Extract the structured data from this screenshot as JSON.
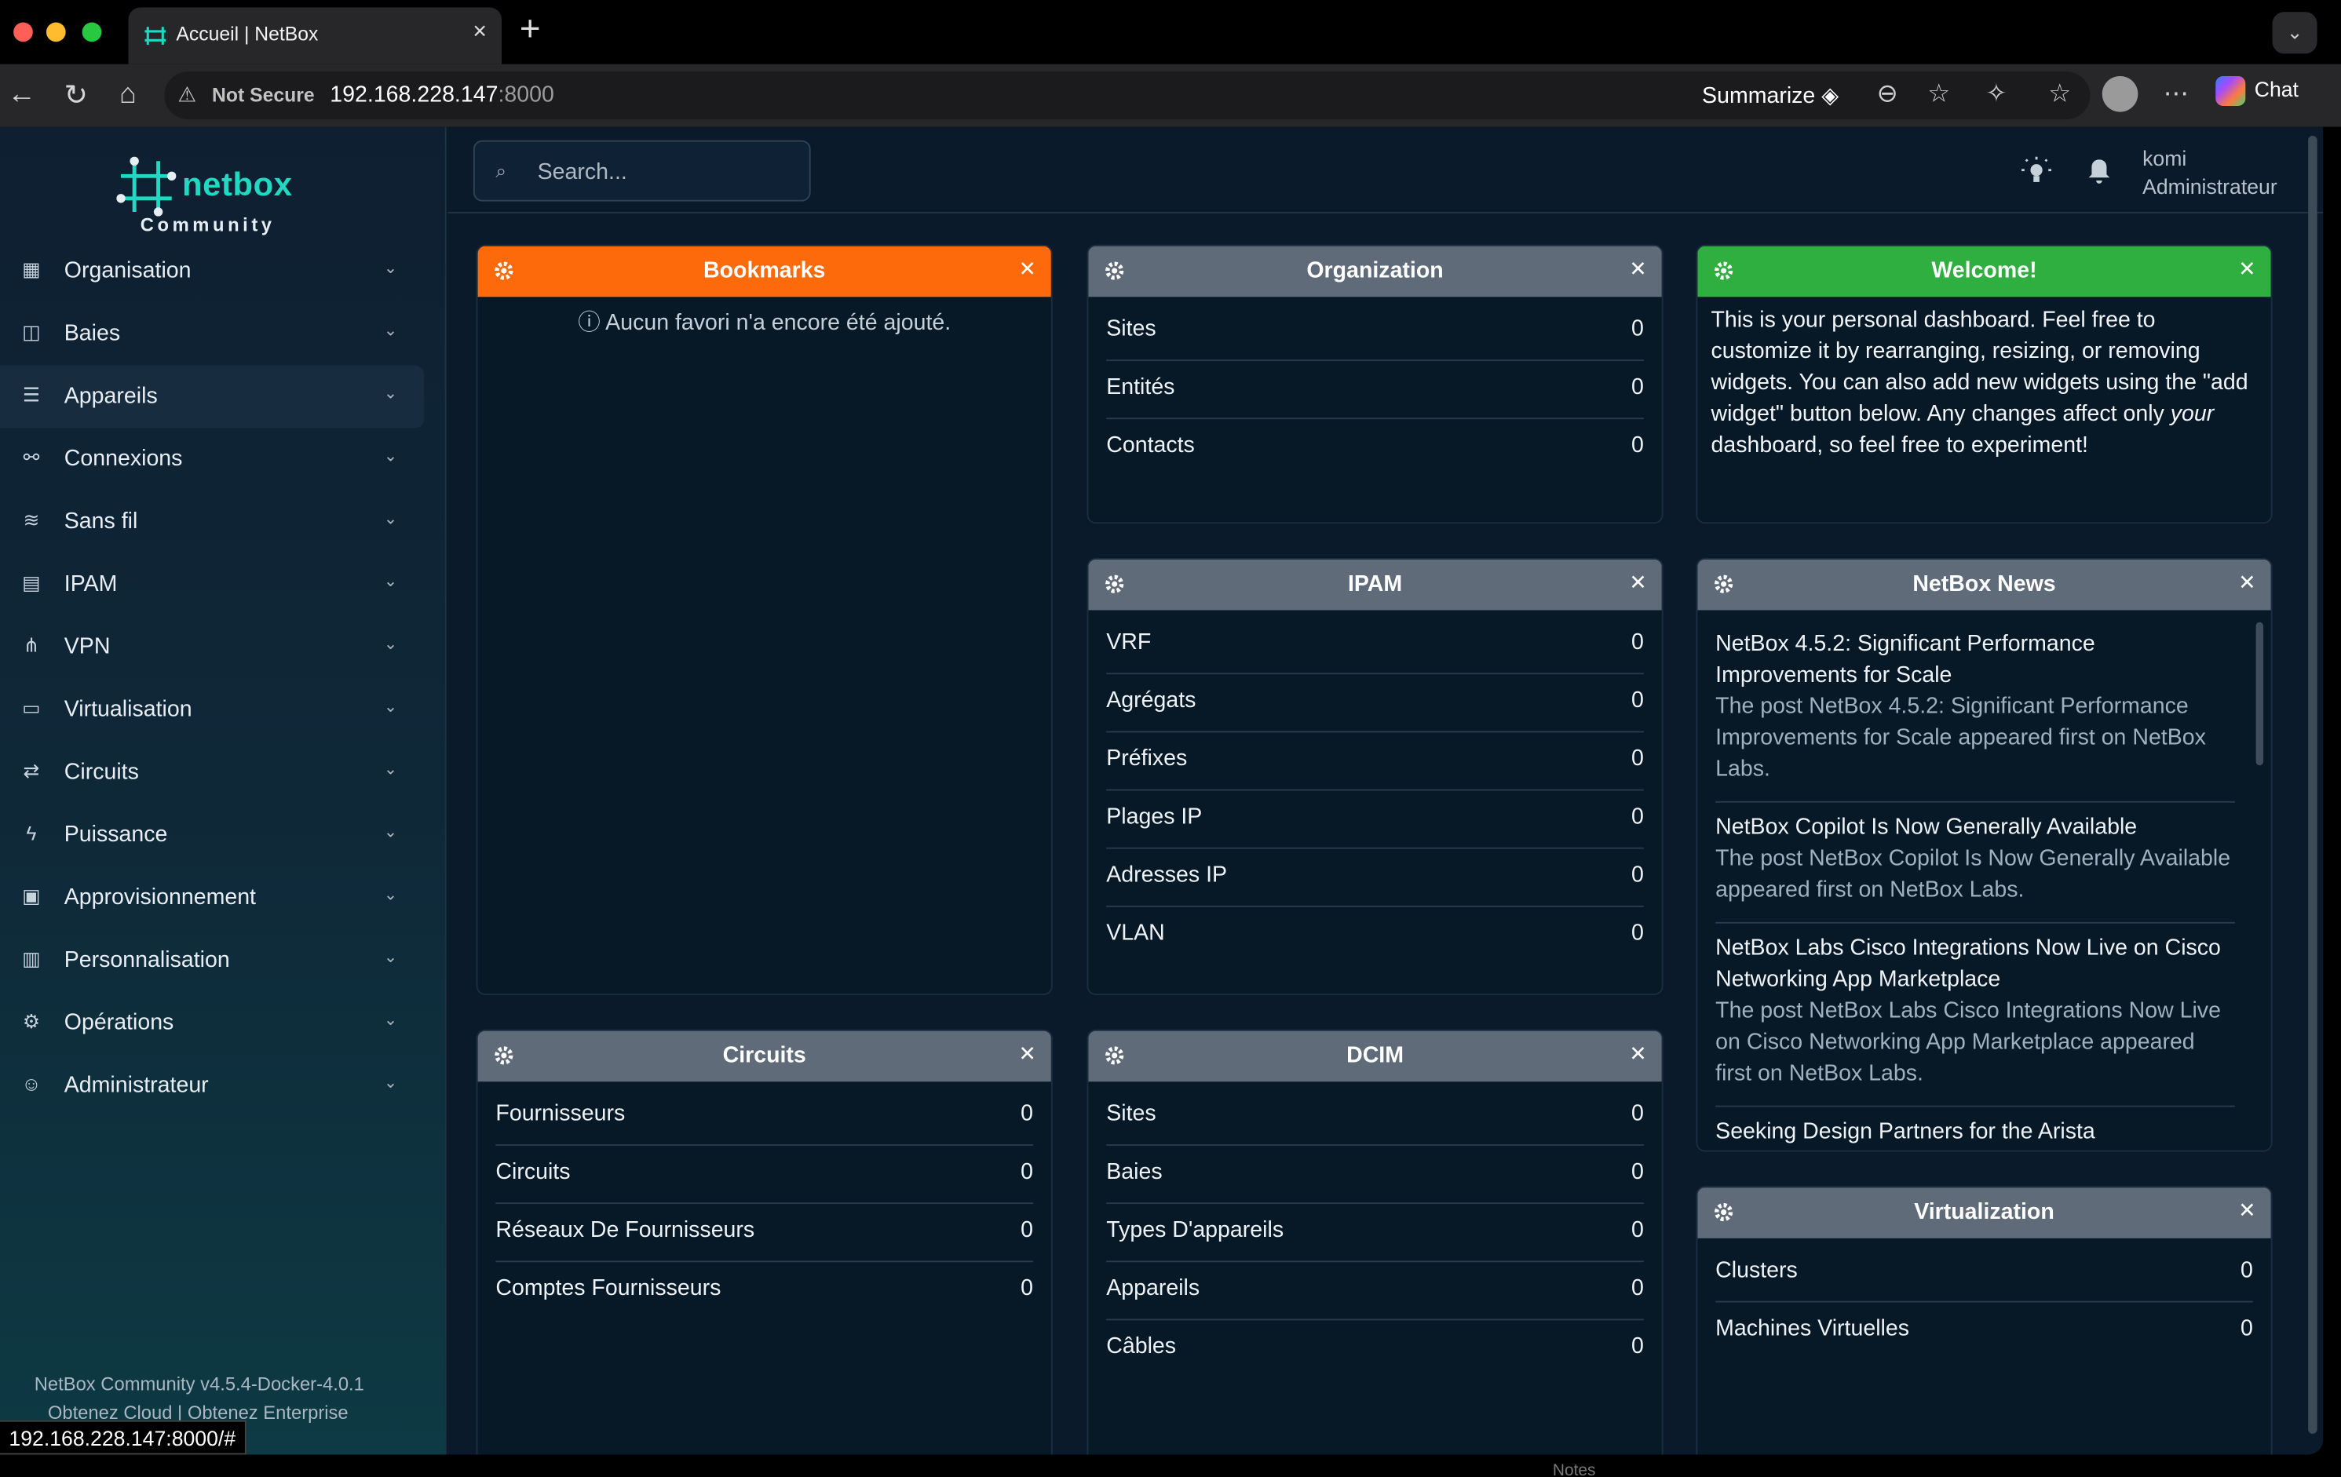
{
  "browser": {
    "tab_title": "Accueil | NetBox",
    "not_secure": "Not Secure",
    "url_host": "192.168.228.147",
    "url_port": ":8000",
    "summarize": "Summarize",
    "chat": "Chat",
    "status_url": "192.168.228.147:8000/#",
    "behind_text": "Notes"
  },
  "sidebar": {
    "brand": "netbox",
    "edition": "Community",
    "items": [
      {
        "label": "Organisation",
        "icon": "organization-icon"
      },
      {
        "label": "Baies",
        "icon": "rack-icon"
      },
      {
        "label": "Appareils",
        "icon": "server-icon"
      },
      {
        "label": "Connexions",
        "icon": "connection-icon"
      },
      {
        "label": "Sans fil",
        "icon": "wifi-icon"
      },
      {
        "label": "IPAM",
        "icon": "ipam-icon"
      },
      {
        "label": "VPN",
        "icon": "vpn-icon"
      },
      {
        "label": "Virtualisation",
        "icon": "monitor-icon"
      },
      {
        "label": "Circuits",
        "icon": "circuits-icon"
      },
      {
        "label": "Puissance",
        "icon": "power-icon"
      },
      {
        "label": "Approvisionnement",
        "icon": "provisioning-icon"
      },
      {
        "label": "Personnalisation",
        "icon": "customization-icon"
      },
      {
        "label": "Opérations",
        "icon": "operations-icon"
      },
      {
        "label": "Administrateur",
        "icon": "users-icon"
      }
    ],
    "footer_version": "NetBox Community v4.5.4-Docker-4.0.1",
    "footer_links": "Obtenez Cloud | Obtenez Enterprise"
  },
  "topbar": {
    "search_placeholder": "Search...",
    "user_name": "komi",
    "user_role": "Administrateur"
  },
  "widgets": {
    "bookmarks": {
      "title": "Bookmarks",
      "empty": "Aucun favori n'a encore été ajouté."
    },
    "organization": {
      "title": "Organization",
      "rows": [
        {
          "label": "Sites",
          "value": "0"
        },
        {
          "label": "Entités",
          "value": "0"
        },
        {
          "label": "Contacts",
          "value": "0"
        }
      ]
    },
    "welcome": {
      "title": "Welcome!",
      "text_1": "This is your personal dashboard. Feel free to customize it by rearranging, resizing, or removing widgets. You can also add new widgets using the \"add widget\" button below. Any changes affect only ",
      "text_em": "your",
      "text_2": " dashboard, so feel free to experiment!"
    },
    "ipam": {
      "title": "IPAM",
      "rows": [
        {
          "label": "VRF",
          "value": "0"
        },
        {
          "label": "Agrégats",
          "value": "0"
        },
        {
          "label": "Préfixes",
          "value": "0"
        },
        {
          "label": "Plages IP",
          "value": "0"
        },
        {
          "label": "Adresses IP",
          "value": "0"
        },
        {
          "label": "VLAN",
          "value": "0"
        }
      ]
    },
    "news": {
      "title": "NetBox News",
      "items": [
        {
          "title": "NetBox 4.5.2: Significant Performance Improvements for Scale",
          "desc": "The post NetBox 4.5.2: Significant Performance Improvements for Scale appeared first on NetBox Labs."
        },
        {
          "title": "NetBox Copilot Is Now Generally Available",
          "desc": "The post NetBox Copilot Is Now Generally Available appeared first on NetBox Labs."
        },
        {
          "title": "NetBox Labs Cisco Integrations Now Live on Cisco Networking App Marketplace",
          "desc": "The post NetBox Labs Cisco Integrations Now Live on Cisco Networking App Marketplace appeared first on NetBox Labs."
        },
        {
          "title": "Seeking Design Partners for the Arista",
          "desc": ""
        }
      ]
    },
    "circuits": {
      "title": "Circuits",
      "rows": [
        {
          "label": "Fournisseurs",
          "value": "0"
        },
        {
          "label": "Circuits",
          "value": "0"
        },
        {
          "label": "Réseaux De Fournisseurs",
          "value": "0"
        },
        {
          "label": "Comptes Fournisseurs",
          "value": "0"
        }
      ]
    },
    "dcim": {
      "title": "DCIM",
      "rows": [
        {
          "label": "Sites",
          "value": "0"
        },
        {
          "label": "Baies",
          "value": "0"
        },
        {
          "label": "Types D'appareils",
          "value": "0"
        },
        {
          "label": "Appareils",
          "value": "0"
        },
        {
          "label": "Câbles",
          "value": "0"
        }
      ]
    },
    "virtualization": {
      "title": "Virtualization",
      "rows": [
        {
          "label": "Clusters",
          "value": "0"
        },
        {
          "label": "Machines Virtuelles",
          "value": "0"
        }
      ]
    }
  },
  "colors": {
    "brand": "#21d8c3",
    "bookmarks_header": "#fd6a0c",
    "welcome_header": "#2faf3f",
    "widget_header": "#606b79"
  }
}
